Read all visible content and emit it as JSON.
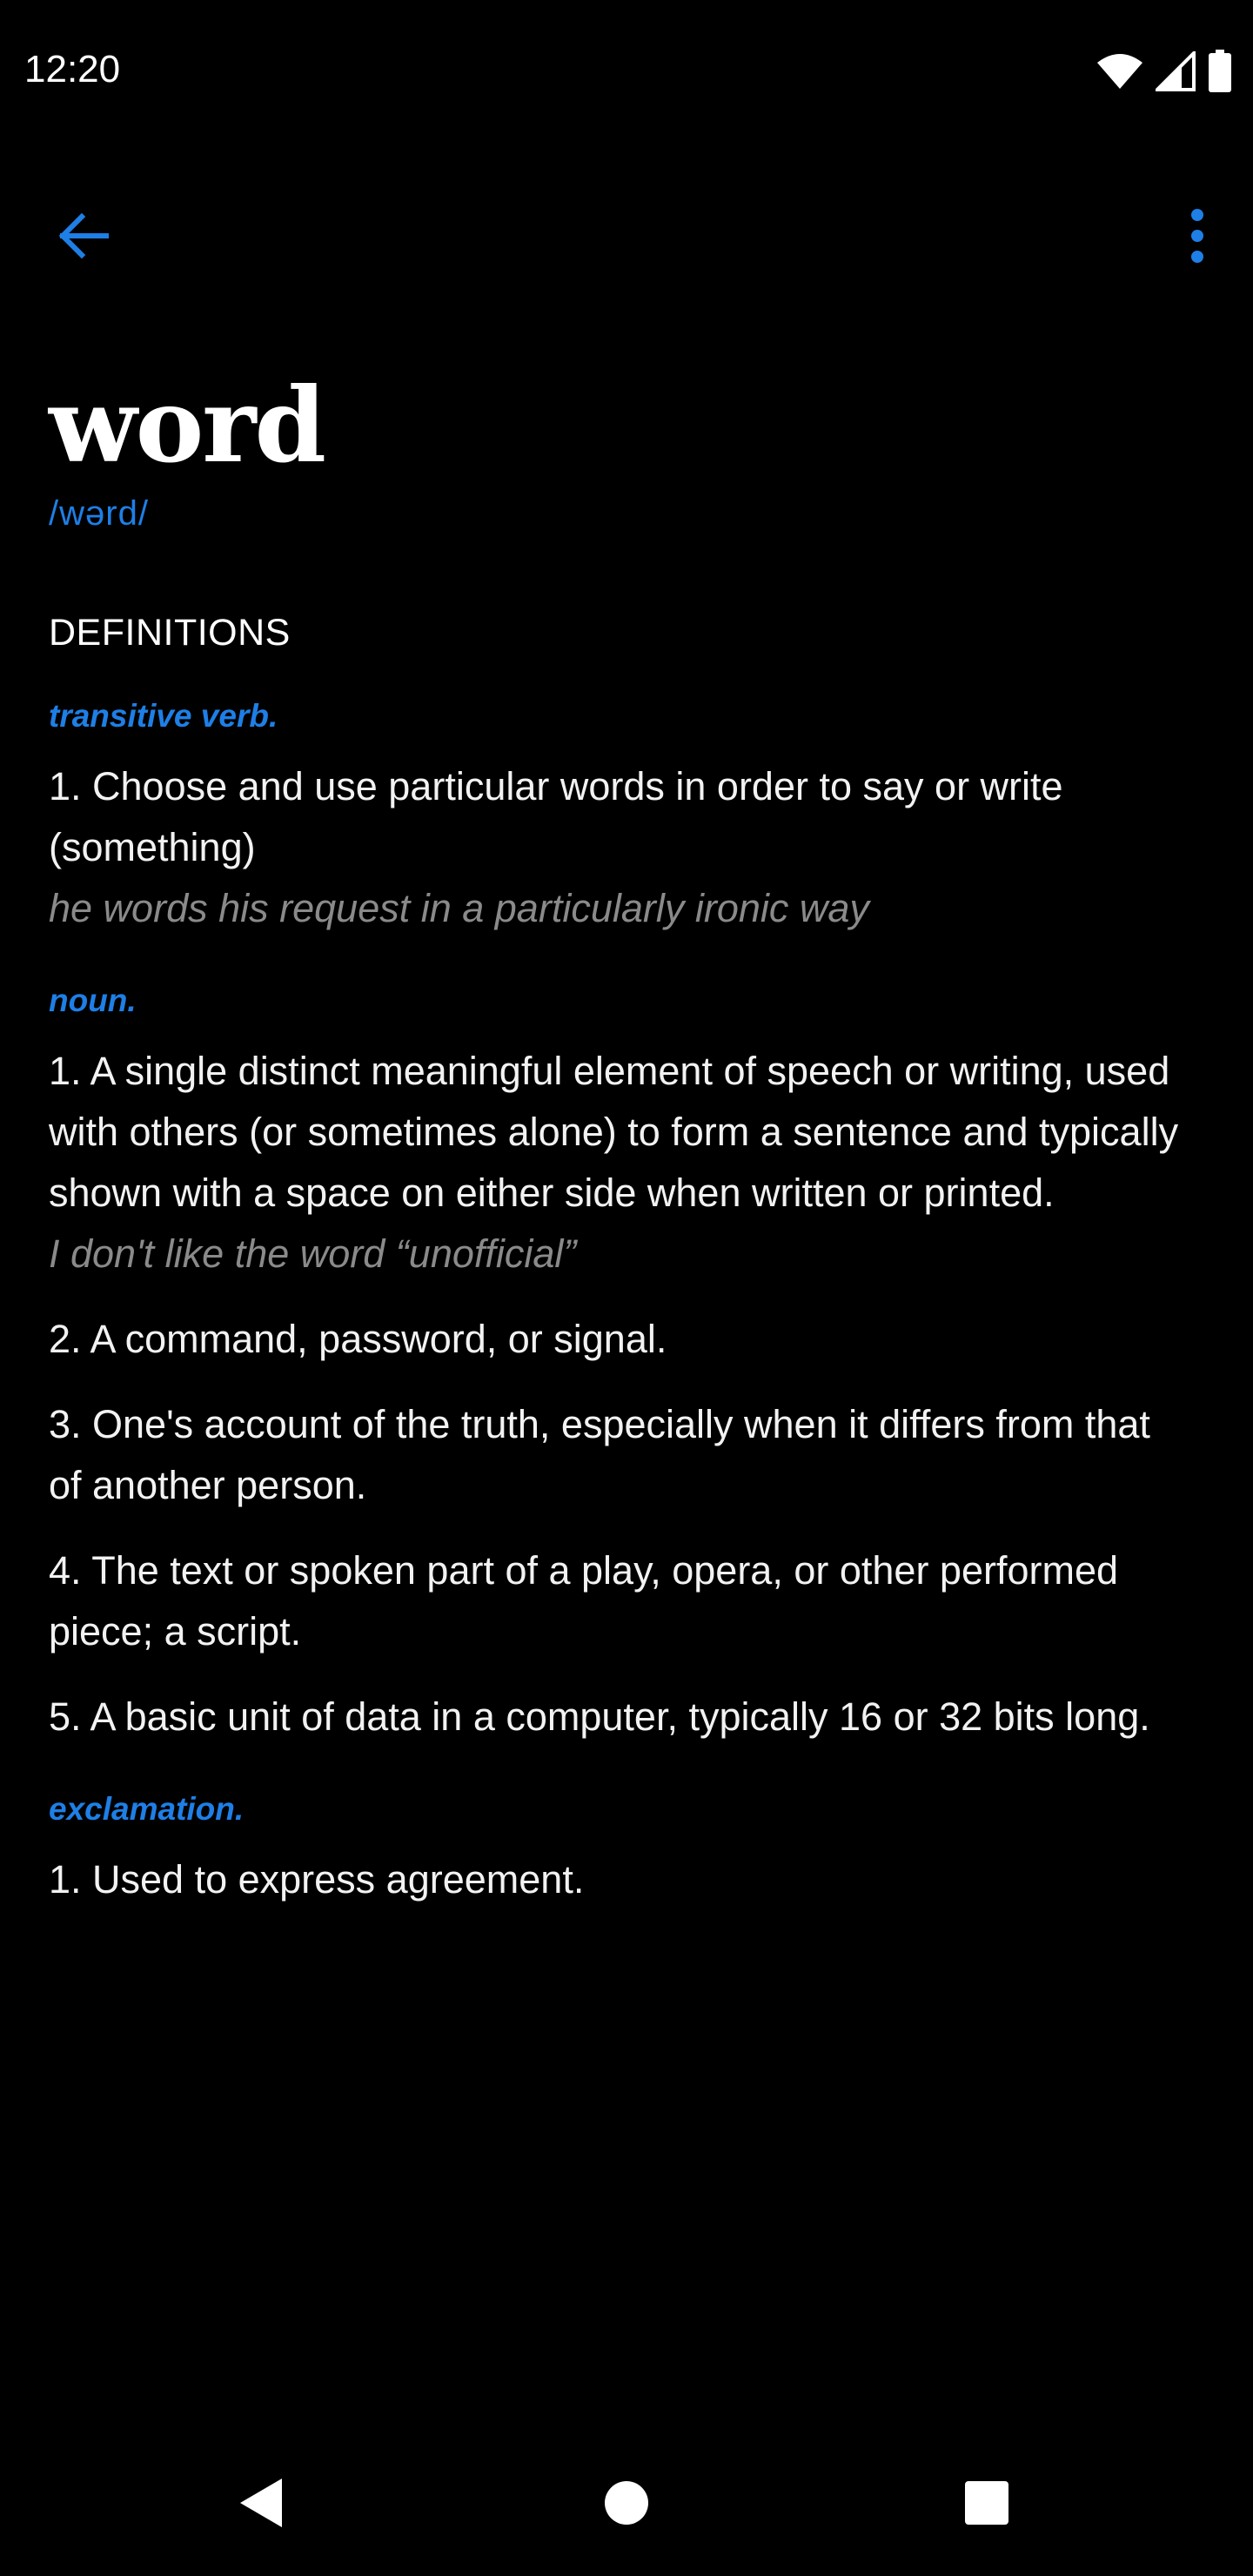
{
  "status_bar": {
    "time": "12:20",
    "icons": [
      "wifi-icon",
      "cell-signal-icon",
      "battery-icon"
    ]
  },
  "app_bar": {
    "back_icon": "arrow-back-icon",
    "menu_icon": "more-vert-icon"
  },
  "entry": {
    "word": "word",
    "phonetic": "/wərd/",
    "definitions_title": "DEFINITIONS",
    "groups": [
      {
        "pos": "transitive verb.",
        "senses": [
          {
            "text": "1. Choose and use particular words in order to say or write (something)",
            "example": "he words his request in a particularly ironic way"
          }
        ]
      },
      {
        "pos": "noun.",
        "senses": [
          {
            "text": "1. A single distinct meaningful element of speech or writing, used with others (or sometimes alone) to form a sentence and typically shown with a space on either side when written or printed.",
            "example": "I don't like the word “unofficial”"
          },
          {
            "text": "2. A command, password, or signal."
          },
          {
            "text": "3. One's account of the truth, especially when it differs from that of another person."
          },
          {
            "text": "4. The text or spoken part of a play, opera, or other performed piece; a script."
          },
          {
            "text": "5. A basic unit of data in a computer, typically 16 or 32 bits long."
          }
        ]
      },
      {
        "pos": "exclamation.",
        "senses": [
          {
            "text": "1. Used to express agreement."
          }
        ]
      }
    ]
  },
  "nav_bar": {
    "back_icon": "nav-back-triangle-icon",
    "home_icon": "nav-home-circle-icon",
    "recents_icon": "nav-recents-square-icon"
  },
  "colors": {
    "accent": "#1e7fe6",
    "background": "#000000",
    "text": "#ffffff",
    "example_text": "#8a8a8a"
  }
}
